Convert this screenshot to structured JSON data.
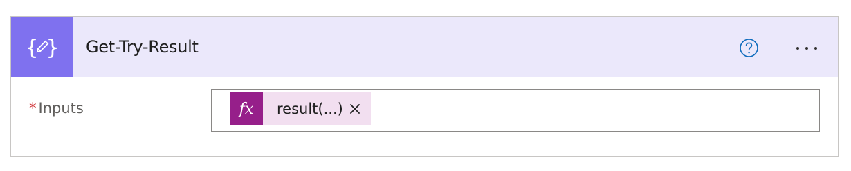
{
  "action": {
    "title": "Get-Try-Result",
    "icon": "variable-edit-icon",
    "accent_color": "#7f71ef",
    "header_background": "#ebe8fb",
    "help_icon": "help-circle-icon",
    "more_icon": "more-options-icon"
  },
  "inputs_field": {
    "required_marker": "*",
    "label": "Inputs",
    "token": {
      "icon_text": "fx",
      "text": "result(...)",
      "remove_icon": "close-icon",
      "color": "#961f8a"
    }
  }
}
